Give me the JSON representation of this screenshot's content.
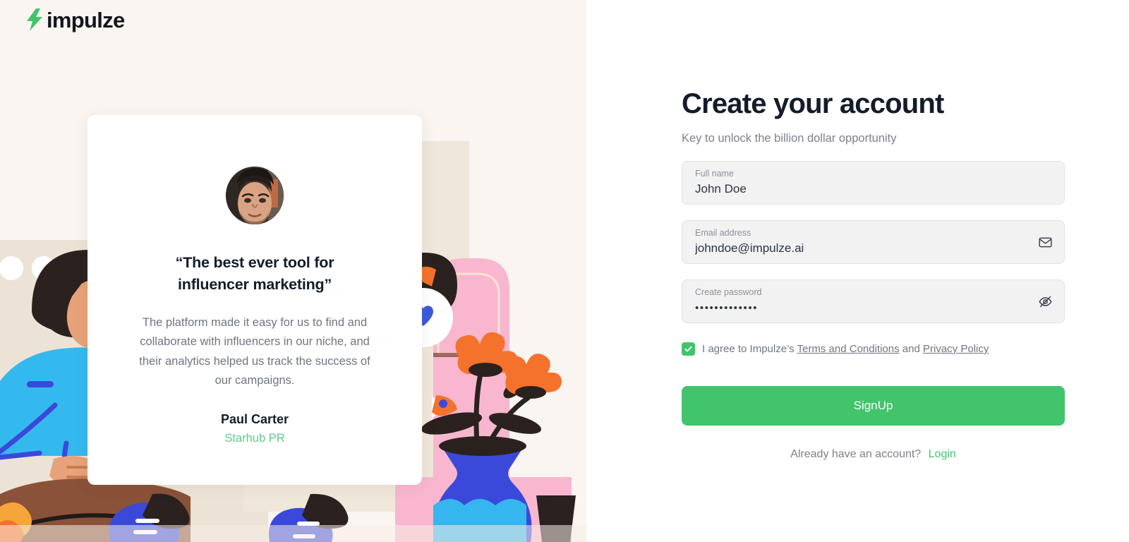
{
  "brand": {
    "name": "impulze",
    "logo_icon": "lightning-bolt-icon",
    "accent_green": "#42c46c",
    "left_bg": "#faf5f1"
  },
  "testimonial": {
    "avatar_icon": "user-photo-avatar",
    "quote": "“The best ever tool for influencer marketing”",
    "body": "The platform made it easy for us to find and collaborate with influencers in our niche, and their analytics helped us track the success of our campaigns.",
    "author": "Paul Carter",
    "organization": "Starhub PR"
  },
  "signup": {
    "title": "Create your account",
    "subtitle": "Key to unlock the billion dollar opportunity",
    "fields": {
      "full_name": {
        "label": "Full name",
        "value": "John Doe",
        "placeholder": "Full name"
      },
      "email": {
        "label": "Email address",
        "value": "johndoe@impulze.ai",
        "placeholder": "Email address",
        "icon": "envelope-icon"
      },
      "password": {
        "label": "Create password",
        "value": "•••••••••••••",
        "placeholder": "Create password",
        "icon": "eye-off-icon"
      }
    },
    "agreement": {
      "checked": true,
      "prefix": "I agree to Impulze’s",
      "terms_link": "Terms and Conditions",
      "conjunction": "and",
      "privacy_link": "Privacy Policy"
    },
    "submit_label": "SignUp",
    "footer_text": "Already have an account?",
    "footer_link": "Login"
  }
}
